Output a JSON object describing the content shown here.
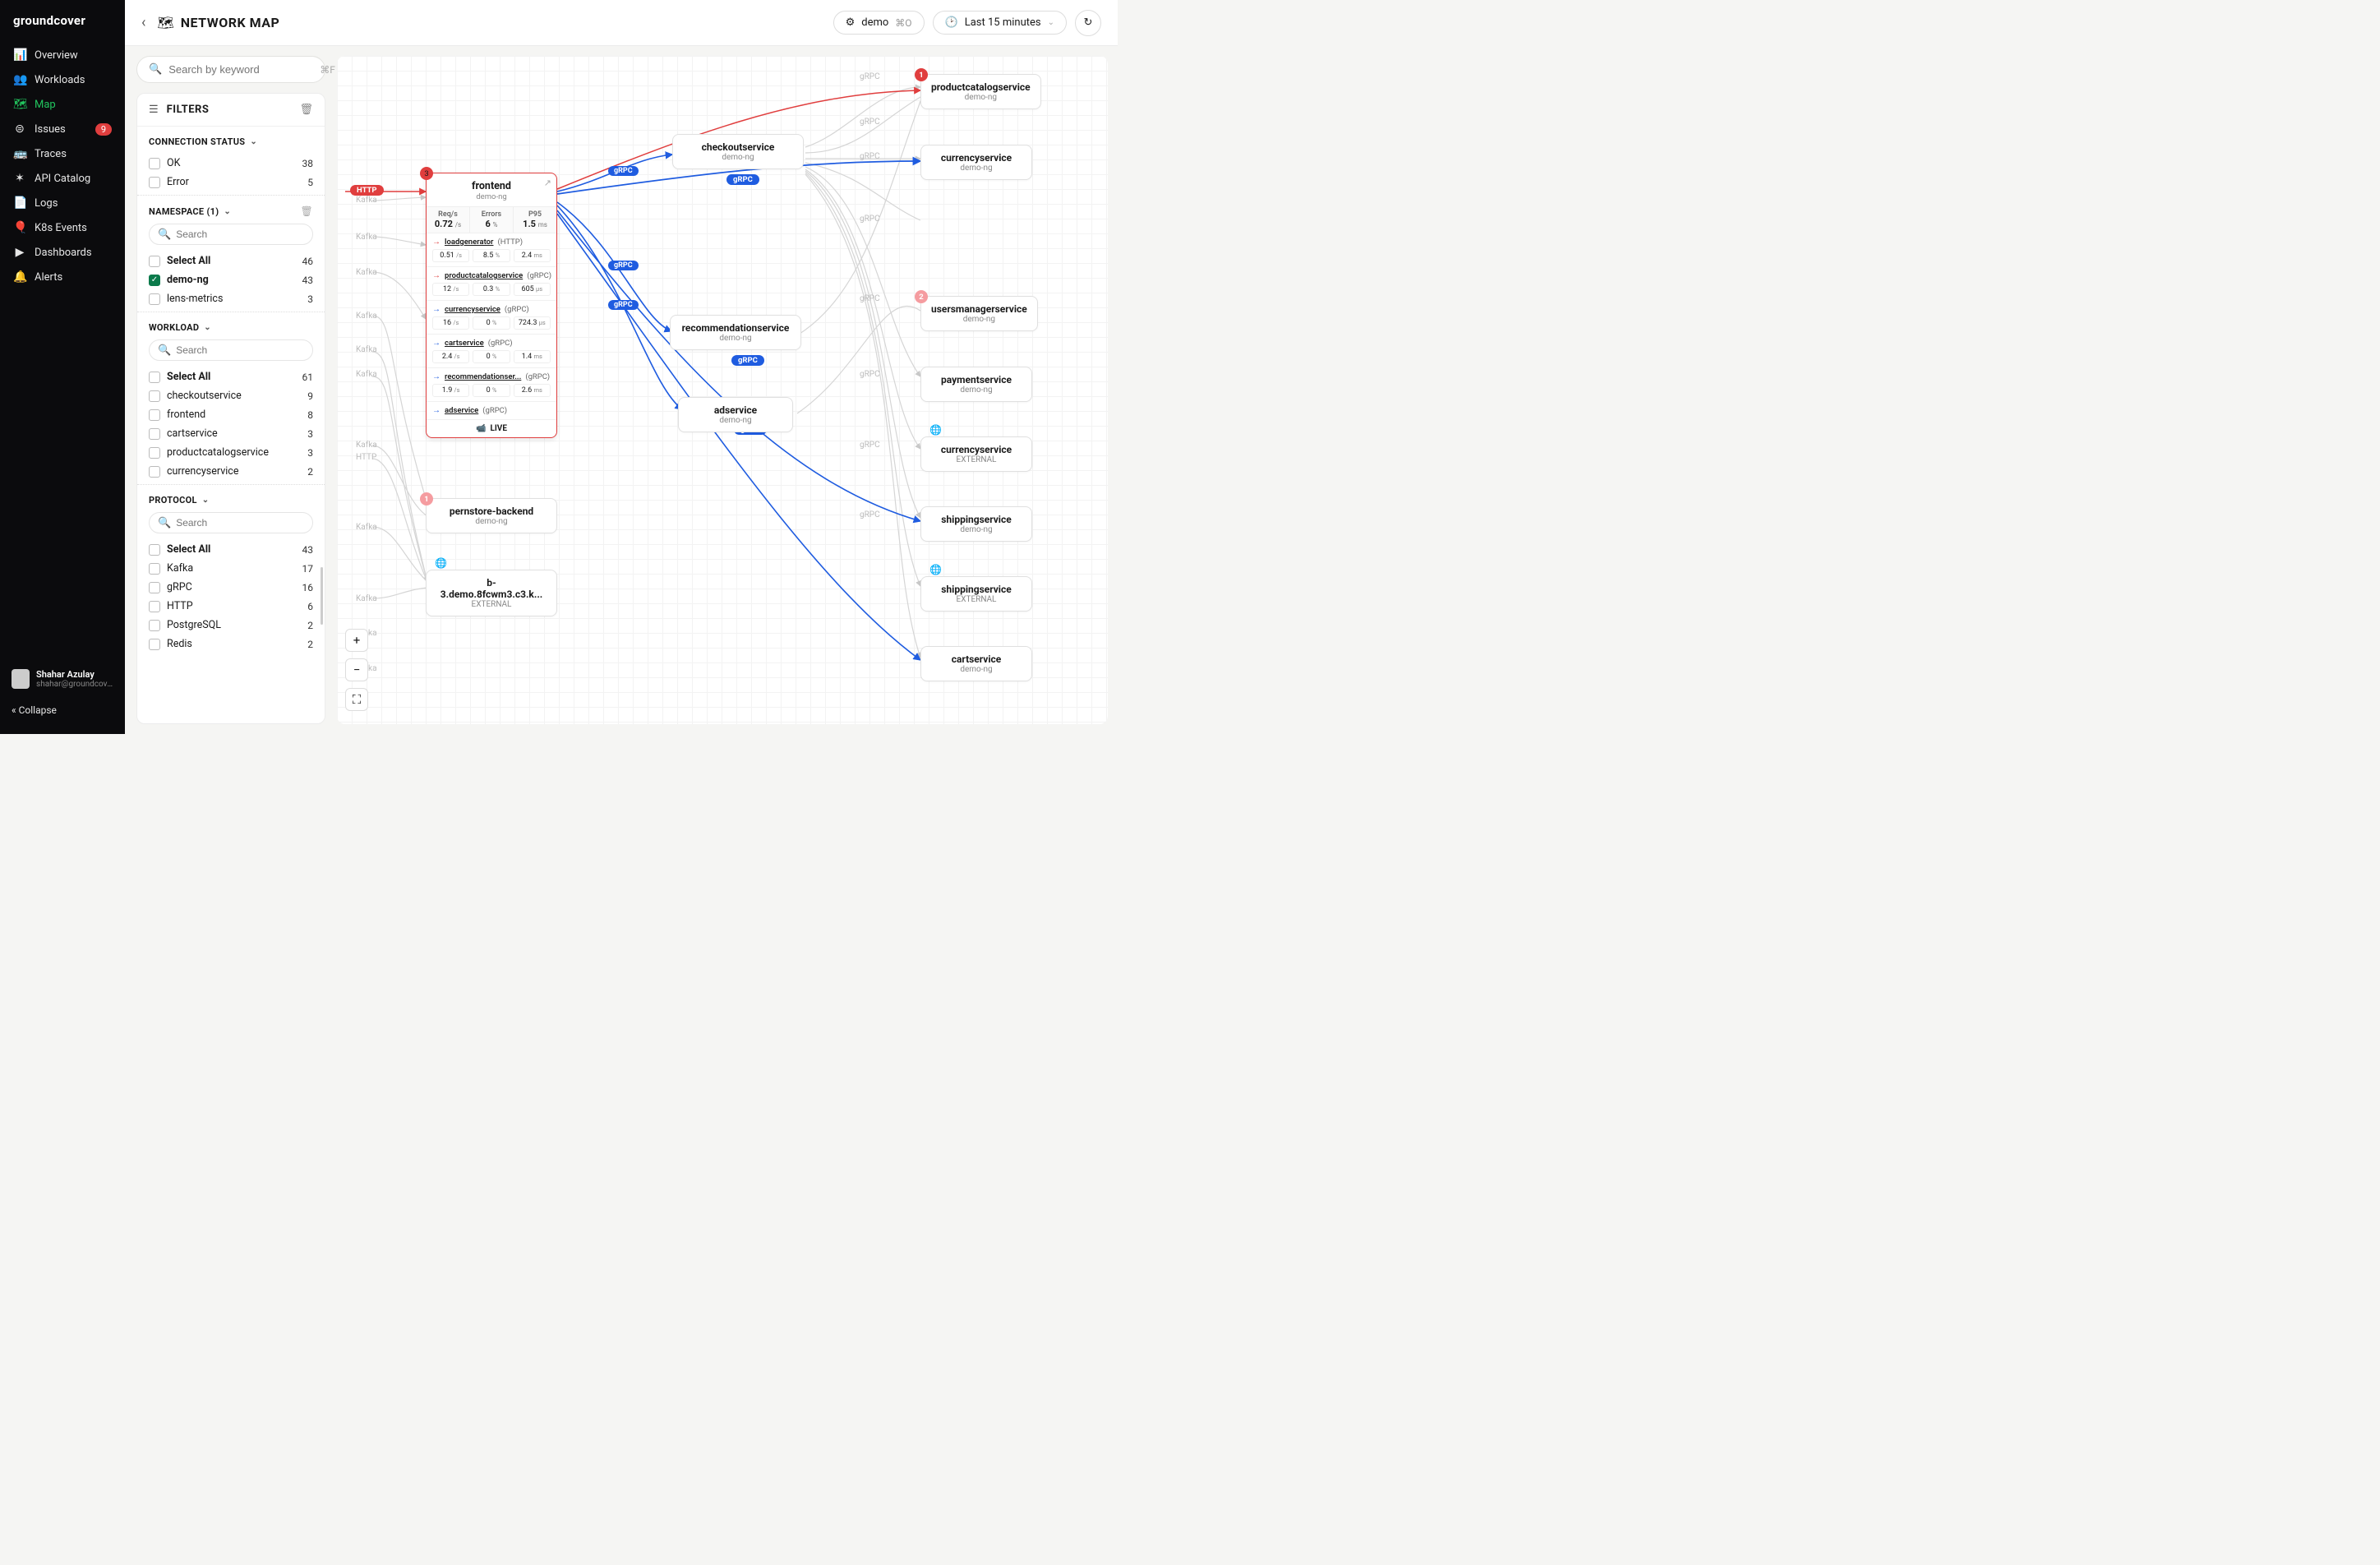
{
  "brand": "groundcover",
  "nav": [
    {
      "icon": "📊",
      "label": "Overview"
    },
    {
      "icon": "👥",
      "label": "Workloads"
    },
    {
      "icon": "🗺",
      "label": "Map",
      "active": true
    },
    {
      "icon": "⊜",
      "label": "Issues",
      "badge": "9"
    },
    {
      "icon": "🚌",
      "label": "Traces"
    },
    {
      "icon": "✶",
      "label": "API Catalog"
    },
    {
      "icon": "📄",
      "label": "Logs"
    },
    {
      "icon": "🎈",
      "label": "K8s Events"
    },
    {
      "icon": "▶",
      "label": "Dashboards"
    },
    {
      "icon": "🔔",
      "label": "Alerts"
    }
  ],
  "user": {
    "name": "Shahar Azulay",
    "email": "shahar@groundcover..."
  },
  "collapse": "« Collapse",
  "header": {
    "title": "NETWORK MAP",
    "icon": "🗺",
    "env": "demo",
    "env_kbd": "⌘O",
    "time": "Last 15 minutes"
  },
  "search": {
    "placeholder": "Search by keyword",
    "kbd": "⌘F"
  },
  "filters_title": "FILTERS",
  "filter_groups": {
    "conn": {
      "title": "CONNECTION STATUS",
      "rows": [
        {
          "label": "OK",
          "count": "38"
        },
        {
          "label": "Error",
          "count": "5"
        }
      ]
    },
    "ns": {
      "title": "NAMESPACE (1)",
      "search_ph": "Search",
      "rows": [
        {
          "label": "Select All",
          "count": "46",
          "bold": true
        },
        {
          "label": "demo-ng",
          "count": "43",
          "bold": true,
          "checked": true
        },
        {
          "label": "lens-metrics",
          "count": "3"
        }
      ]
    },
    "wl": {
      "title": "WORKLOAD",
      "search_ph": "Search",
      "rows": [
        {
          "label": "Select All",
          "count": "61",
          "bold": true
        },
        {
          "label": "checkoutservice",
          "count": "9"
        },
        {
          "label": "frontend",
          "count": "8"
        },
        {
          "label": "cartservice",
          "count": "3"
        },
        {
          "label": "productcatalogservice",
          "count": "3"
        },
        {
          "label": "currencyservice",
          "count": "2"
        }
      ]
    },
    "proto": {
      "title": "PROTOCOL",
      "search_ph": "Search",
      "rows": [
        {
          "label": "Select All",
          "count": "43",
          "bold": true
        },
        {
          "label": "Kafka",
          "count": "17"
        },
        {
          "label": "gRPC",
          "count": "16"
        },
        {
          "label": "HTTP",
          "count": "6"
        },
        {
          "label": "PostgreSQL",
          "count": "2"
        },
        {
          "label": "Redis",
          "count": "2"
        }
      ]
    }
  },
  "selected_node": {
    "title": "frontend",
    "sub": "demo-ng",
    "badge": "3",
    "stats": [
      {
        "h": "Req/s",
        "v": "0.72",
        "u": "/s"
      },
      {
        "h": "Errors",
        "v": "6",
        "u": "%"
      },
      {
        "h": "P95",
        "v": "1.5",
        "u": "ms"
      }
    ],
    "conns": [
      {
        "dir": "in",
        "color": "red",
        "svc": "loadgenerator",
        "proto": "(HTTP)",
        "vals": [
          {
            "v": "0.51",
            "u": "/s"
          },
          {
            "v": "8.5",
            "u": "%"
          },
          {
            "v": "2.4",
            "u": "ms"
          }
        ]
      },
      {
        "dir": "out",
        "color": "red",
        "svc": "productcatalogservice",
        "proto": "(gRPC)",
        "vals": [
          {
            "v": "12",
            "u": "/s"
          },
          {
            "v": "0.3",
            "u": "%"
          },
          {
            "v": "605",
            "u": "µs"
          }
        ]
      },
      {
        "dir": "out",
        "color": "blue",
        "svc": "currencyservice",
        "proto": "(gRPC)",
        "vals": [
          {
            "v": "16",
            "u": "/s"
          },
          {
            "v": "0",
            "u": "%"
          },
          {
            "v": "724.3",
            "u": "µs"
          }
        ]
      },
      {
        "dir": "out",
        "color": "blue",
        "svc": "cartservice",
        "proto": "(gRPC)",
        "vals": [
          {
            "v": "2.4",
            "u": "/s"
          },
          {
            "v": "0",
            "u": "%"
          },
          {
            "v": "1.4",
            "u": "ms"
          }
        ]
      },
      {
        "dir": "out",
        "color": "blue",
        "svc": "recommendationser...",
        "proto": "(gRPC)",
        "vals": [
          {
            "v": "1.9",
            "u": "/s"
          },
          {
            "v": "0",
            "u": "%"
          },
          {
            "v": "2.6",
            "u": "ms"
          }
        ]
      },
      {
        "dir": "out",
        "color": "blue",
        "svc": "adservice",
        "proto": "(gRPC)"
      }
    ],
    "live": "LIVE"
  },
  "edge_labels": {
    "kafka": "Kafka",
    "grpc": "gRPC",
    "http": "HTTP",
    "ka": "ka"
  },
  "nodes": {
    "checkout": {
      "title": "checkoutservice",
      "sub": "demo-ng"
    },
    "recommendation": {
      "title": "recommendationservice",
      "sub": "demo-ng"
    },
    "adservice": {
      "title": "adservice",
      "sub": "demo-ng"
    },
    "pernstore": {
      "title": "pernstore-backend",
      "sub": "demo-ng"
    },
    "b3": {
      "title": "b-3.demo.8fcwm3.c3.k...",
      "sub": "EXTERNAL"
    },
    "productcatalog": {
      "title": "productcatalogservice",
      "sub": "demo-ng",
      "badge": "1"
    },
    "currency": {
      "title": "currencyservice",
      "sub": "demo-ng"
    },
    "usersmanager": {
      "title": "usersmanagerservice",
      "sub": "demo-ng",
      "badge": "2"
    },
    "payment": {
      "title": "paymentservice",
      "sub": "demo-ng"
    },
    "currencyext": {
      "title": "currencyservice",
      "sub": "EXTERNAL"
    },
    "shipping": {
      "title": "shippingservice",
      "sub": "demo-ng"
    },
    "shippingext": {
      "title": "shippingservice",
      "sub": "EXTERNAL"
    },
    "cart": {
      "title": "cartservice",
      "sub": "demo-ng"
    }
  },
  "proto_labels": {
    "http": "HTTP",
    "grpc": "gRPC"
  },
  "ka_labels": {
    "ka": "ka"
  }
}
